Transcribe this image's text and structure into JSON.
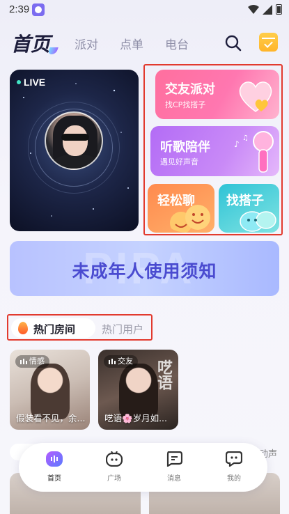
{
  "status_bar": {
    "time": "2:39"
  },
  "top_nav": {
    "tabs": [
      {
        "label": "首页",
        "active": true
      },
      {
        "label": "派对",
        "active": false
      },
      {
        "label": "点单",
        "active": false
      },
      {
        "label": "电台",
        "active": false
      }
    ]
  },
  "live_card": {
    "badge": "LIVE"
  },
  "features": [
    {
      "title": "交友派对",
      "subtitle": "找CP找搭子",
      "icon": "heart-icon"
    },
    {
      "title": "听歌陪伴",
      "subtitle": "遇见好声音",
      "icon": "microphone-icon"
    },
    {
      "title": "轻松聊",
      "icon": "emoji-faces-icon"
    },
    {
      "title": "找搭子",
      "icon": "chat-bubbles-icon"
    }
  ],
  "notice": {
    "text": "未成年人使用须知",
    "watermark": "PIPA"
  },
  "section_tabs": [
    {
      "label": "热门房间",
      "active": true
    },
    {
      "label": "热门用户",
      "active": false
    }
  ],
  "rooms": [
    {
      "tag": "情感",
      "title": "假装看不见，余..."
    },
    {
      "tag": "交友",
      "title": "呓语🌸岁月如..."
    }
  ],
  "room2_deco": "呓语",
  "peek": {
    "right_label": "动声"
  },
  "bottom_nav": [
    {
      "label": "首页",
      "icon": "home-icon",
      "active": true
    },
    {
      "label": "广场",
      "icon": "plaza-icon",
      "active": false
    },
    {
      "label": "消息",
      "icon": "message-icon",
      "active": false
    },
    {
      "label": "我的",
      "icon": "profile-icon",
      "active": false
    }
  ],
  "colors": {
    "accent": "#7b6cf0",
    "highlight_border": "#e23a2e",
    "notice_text": "#4a4bd0"
  }
}
